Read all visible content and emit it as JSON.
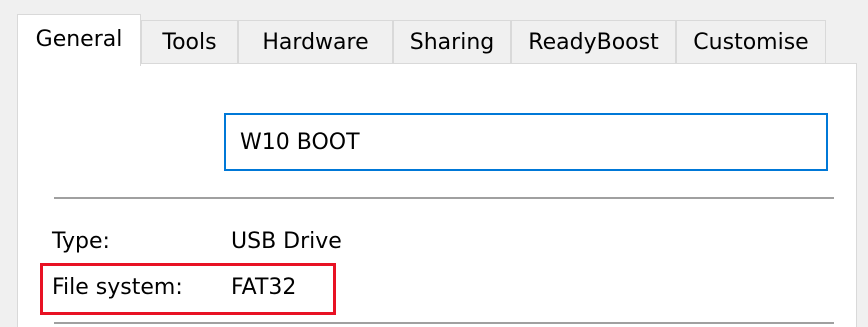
{
  "tabs": [
    {
      "label": "General",
      "active": true
    },
    {
      "label": "Tools",
      "active": false
    },
    {
      "label": "Hardware",
      "active": false
    },
    {
      "label": "Sharing",
      "active": false
    },
    {
      "label": "ReadyBoost",
      "active": false
    },
    {
      "label": "Customise",
      "active": false
    }
  ],
  "general": {
    "volume_name": "W10 BOOT",
    "type_label": "Type:",
    "type_value": "USB Drive",
    "filesystem_label": "File system:",
    "filesystem_value": "FAT32"
  },
  "colors": {
    "focus_border": "#0078d7",
    "highlight": "#e81123",
    "window_bg": "#f0f0f0"
  }
}
